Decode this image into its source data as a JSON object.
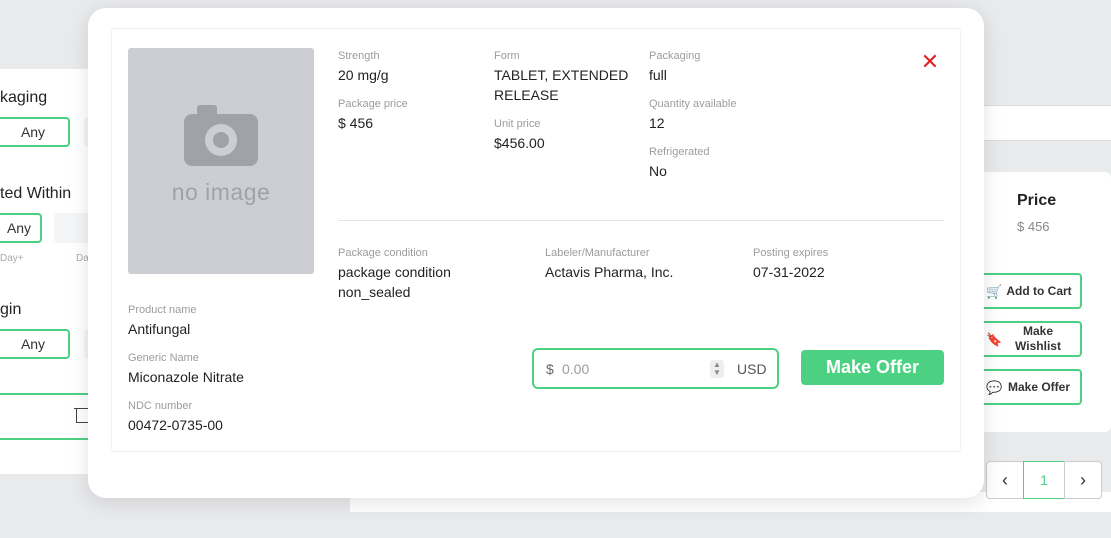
{
  "background": {
    "filters": [
      {
        "title": "kaging",
        "button": "Any"
      },
      {
        "title": "ted Within",
        "button": "Any",
        "sub_labels": [
          "Day+",
          "Da"
        ]
      },
      {
        "title": "gin",
        "button": "Any"
      }
    ],
    "side_card": {
      "price_title": "Price",
      "price_value": "$ 456",
      "add_to_cart": "Add to Cart",
      "make_wishlist": "Make Wishlist",
      "make_offer": "Make Offer"
    },
    "pagination": {
      "prev": "‹",
      "page": "1",
      "next": "›"
    }
  },
  "product": {
    "image_placeholder": "no image",
    "strength": {
      "label": "Strength",
      "value": "20 mg/g"
    },
    "form": {
      "label": "Form",
      "value": "TABLET, EXTENDED RELEASE"
    },
    "packaging": {
      "label": "Packaging",
      "value": "full"
    },
    "package_price": {
      "label": "Package price",
      "value": "$ 456"
    },
    "unit_price": {
      "label": "Unit price",
      "value": "$456.00"
    },
    "quantity_available": {
      "label": "Quantity available",
      "value": "12"
    },
    "refrigerated": {
      "label": "Refrigerated",
      "value": "No"
    },
    "package_condition": {
      "label": "Package condition",
      "value": "package condition non_sealed"
    },
    "labeler": {
      "label": "Labeler/Manufacturer",
      "value": "Actavis Pharma, Inc."
    },
    "posting_expires": {
      "label": "Posting expires",
      "value": "07-31-2022"
    },
    "product_name": {
      "label": "Product name",
      "value": "Antifungal"
    },
    "generic_name": {
      "label": "Generic Name",
      "value": "Miconazole Nitrate"
    },
    "ndc_number": {
      "label": "NDC number",
      "value": "00472-0735-00"
    }
  },
  "offer": {
    "currency_symbol": "$",
    "placeholder": "0.00",
    "currency_code": "USD",
    "button_label": "Make Offer"
  },
  "colors": {
    "accent": "#4cd183",
    "close": "#e02424"
  }
}
